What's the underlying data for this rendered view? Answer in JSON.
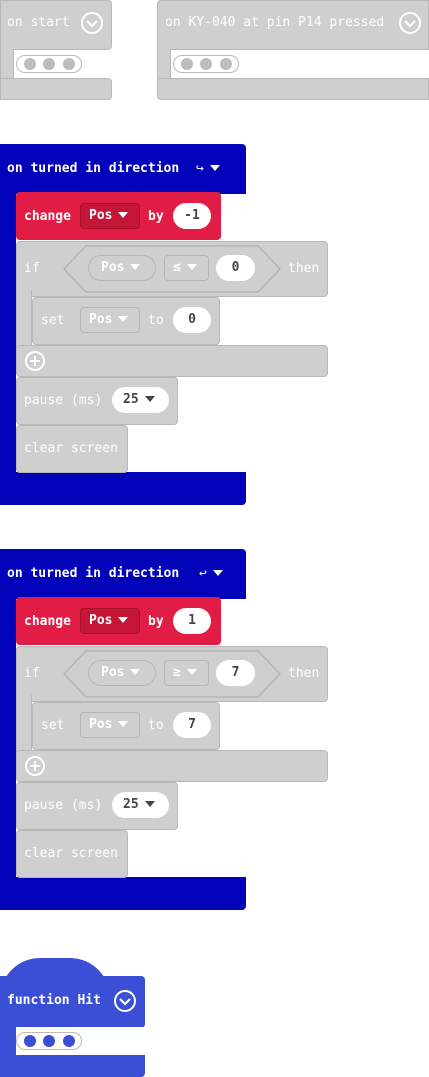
{
  "blocks": {
    "on_start": {
      "label": "on start"
    },
    "on_pressed": {
      "label": "on KY-040 at pin P14 pressed"
    },
    "turn1": {
      "header": "on turned in direction",
      "direction_icon": "↪",
      "change_label": "change",
      "var": "Pos",
      "by_label": "by",
      "by_value": "-1",
      "if_label": "if",
      "cond_var": "Pos",
      "cond_op": "≤",
      "cond_value": "0",
      "then_label": "then",
      "set_label": "set",
      "set_var": "Pos",
      "to_label": "to",
      "set_value": "0",
      "pause_label": "pause (ms)",
      "pause_value": "25",
      "clear_label": "clear screen"
    },
    "turn2": {
      "header": "on turned in direction",
      "direction_icon": "↩",
      "change_label": "change",
      "var": "Pos",
      "by_label": "by",
      "by_value": "1",
      "if_label": "if",
      "cond_var": "Pos",
      "cond_op": "≥",
      "cond_value": "7",
      "then_label": "then",
      "set_label": "set",
      "set_var": "Pos",
      "to_label": "to",
      "set_value": "7",
      "pause_label": "pause (ms)",
      "pause_value": "25",
      "clear_label": "clear screen"
    },
    "function_hit": {
      "label": "function Hit"
    }
  },
  "colors": {
    "event_navy": "#0202b8",
    "variable_red": "#e21d45",
    "disabled_gray": "#cfcfcf",
    "function_blue": "#3a4fd6"
  }
}
